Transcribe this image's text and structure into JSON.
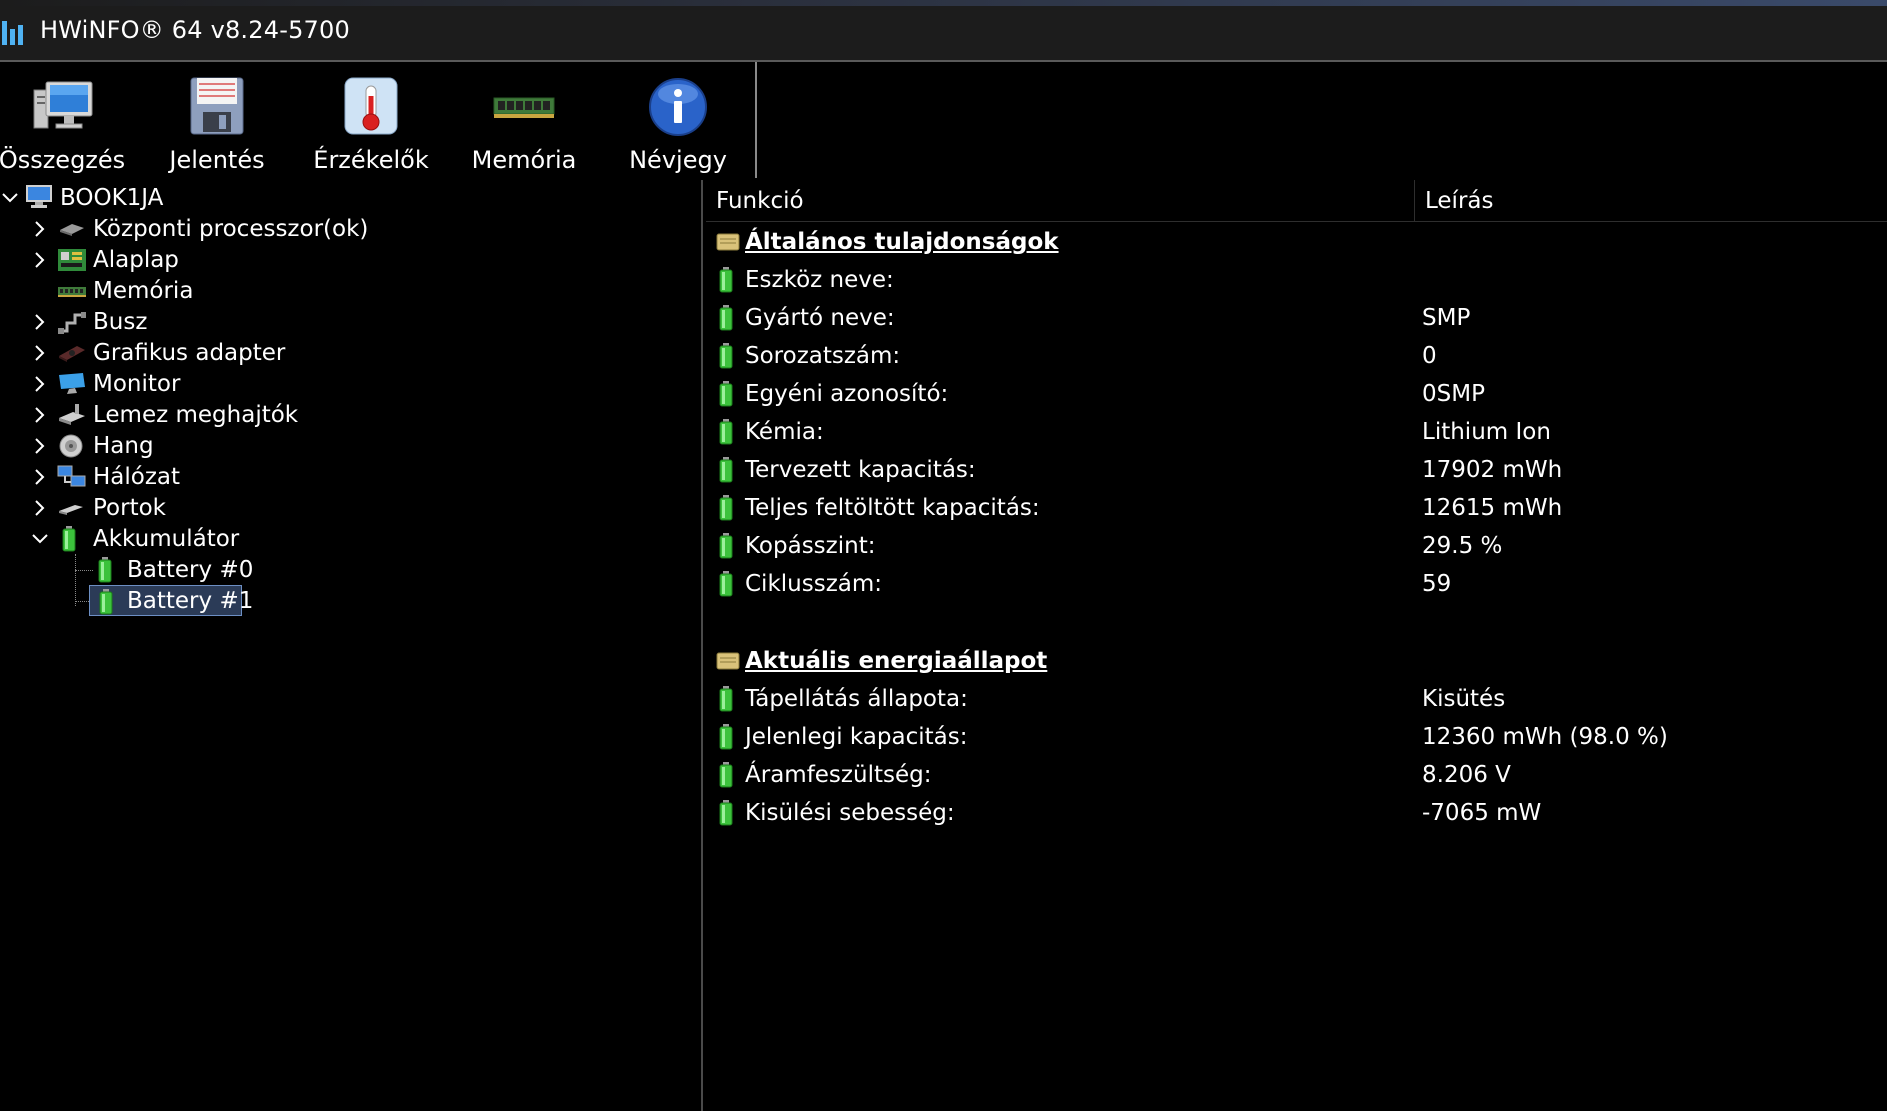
{
  "window": {
    "title": "HWiNFO® 64 v8.24-5700"
  },
  "toolbar": {
    "summary": "Összegzés",
    "report": "Jelentés",
    "sensors": "Érzékelők",
    "memory": "Memória",
    "about": "Névjegy"
  },
  "tree": {
    "root": "BOOK1JA",
    "items": [
      {
        "label": "Központi processzor(ok)",
        "icon": "cpu-icon"
      },
      {
        "label": "Alaplap",
        "icon": "motherboard-icon"
      },
      {
        "label": "Memória",
        "icon": "memory-icon"
      },
      {
        "label": "Busz",
        "icon": "bus-icon"
      },
      {
        "label": "Grafikus adapter",
        "icon": "gpu-icon"
      },
      {
        "label": "Monitor",
        "icon": "monitor-icon"
      },
      {
        "label": "Lemez meghajtók",
        "icon": "disk-icon"
      },
      {
        "label": "Hang",
        "icon": "audio-icon"
      },
      {
        "label": "Hálózat",
        "icon": "network-icon"
      },
      {
        "label": "Portok",
        "icon": "ports-icon"
      },
      {
        "label": "Akkumulátor",
        "icon": "battery-icon"
      }
    ],
    "battery_children": [
      {
        "label": "Battery #0"
      },
      {
        "label": "Battery #1",
        "selected": true
      }
    ]
  },
  "detail": {
    "columns": {
      "function": "Funkció",
      "description": "Leírás"
    },
    "sections": [
      {
        "title": "Általános tulajdonságok",
        "rows": [
          {
            "key": "Eszköz neve:",
            "value": ""
          },
          {
            "key": "Gyártó neve:",
            "value": "SMP"
          },
          {
            "key": "Sorozatszám:",
            "value": "0"
          },
          {
            "key": "Egyéni azonosító:",
            "value": "0SMP"
          },
          {
            "key": "Kémia:",
            "value": "Lithium Ion"
          },
          {
            "key": "Tervezett kapacitás:",
            "value": "17902 mWh"
          },
          {
            "key": "Teljes feltöltött kapacitás:",
            "value": "12615 mWh"
          },
          {
            "key": "Kopásszint:",
            "value": "29.5 %"
          },
          {
            "key": "Ciklusszám:",
            "value": "59"
          }
        ]
      },
      {
        "title": "Aktuális energiaállapot",
        "rows": [
          {
            "key": "Tápellátás állapota:",
            "value": "Kisütés"
          },
          {
            "key": "Jelenlegi kapacitás:",
            "value": "12360 mWh (98.0 %)"
          },
          {
            "key": "Áramfeszültség:",
            "value": "8.206 V"
          },
          {
            "key": "Kisülési sebesség:",
            "value": "-7065 mW"
          }
        ]
      }
    ]
  },
  "colors": {
    "selection_bg": "#2b3b57",
    "selection_border": "#6d8fc4",
    "battery_green": "#3cc23c"
  }
}
